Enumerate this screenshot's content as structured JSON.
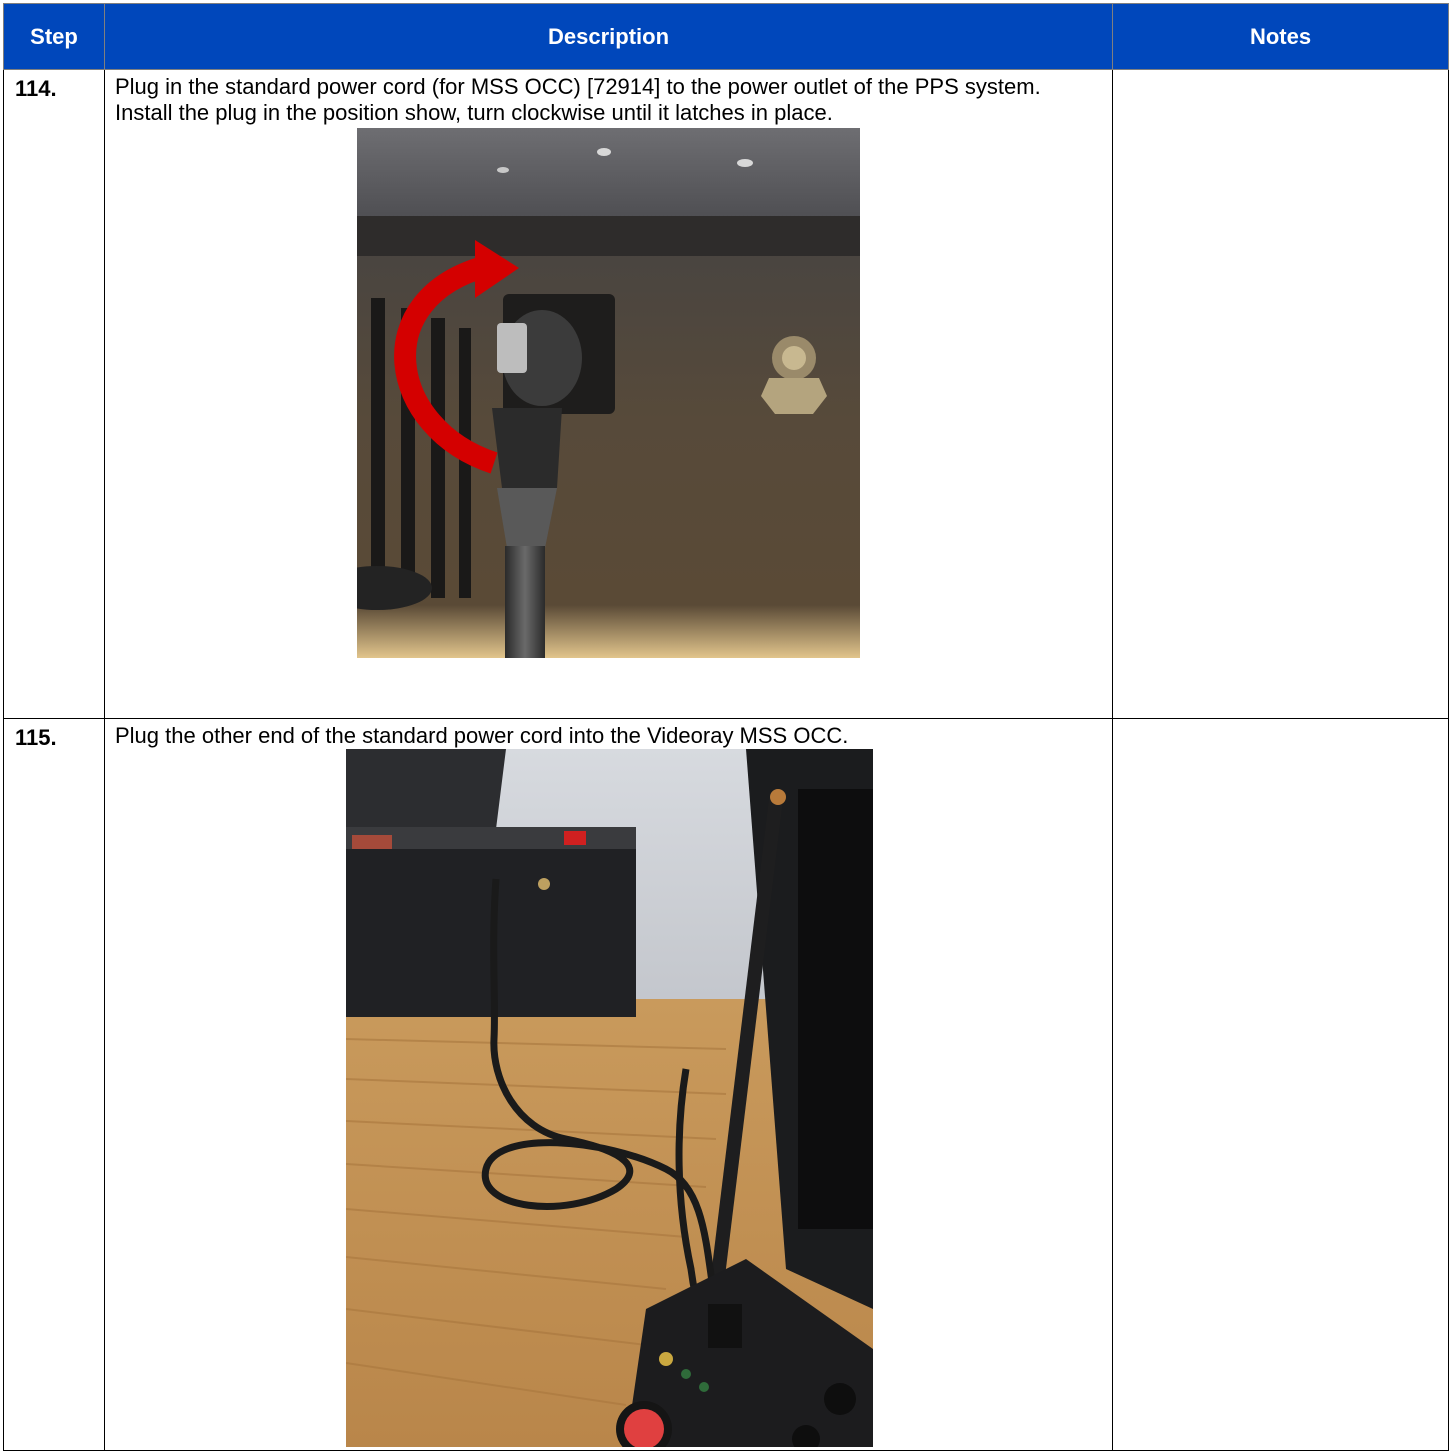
{
  "table": {
    "headers": {
      "step": "Step",
      "description": "Description",
      "notes": "Notes"
    },
    "rows": [
      {
        "step": "114.",
        "description": "Plug in the standard power cord (for MSS OCC) [72914] to the power outlet of the PPS system. Install the plug in the position show, turn clockwise until it latches in place.",
        "notes": ""
      },
      {
        "step": "115.",
        "description": "Plug the other end of the standard power cord into the Videoray MSS OCC.",
        "notes": ""
      }
    ]
  },
  "colors": {
    "header_bg": "#0047bb",
    "header_text": "#ffffff",
    "arrow_red": "#d40000"
  }
}
